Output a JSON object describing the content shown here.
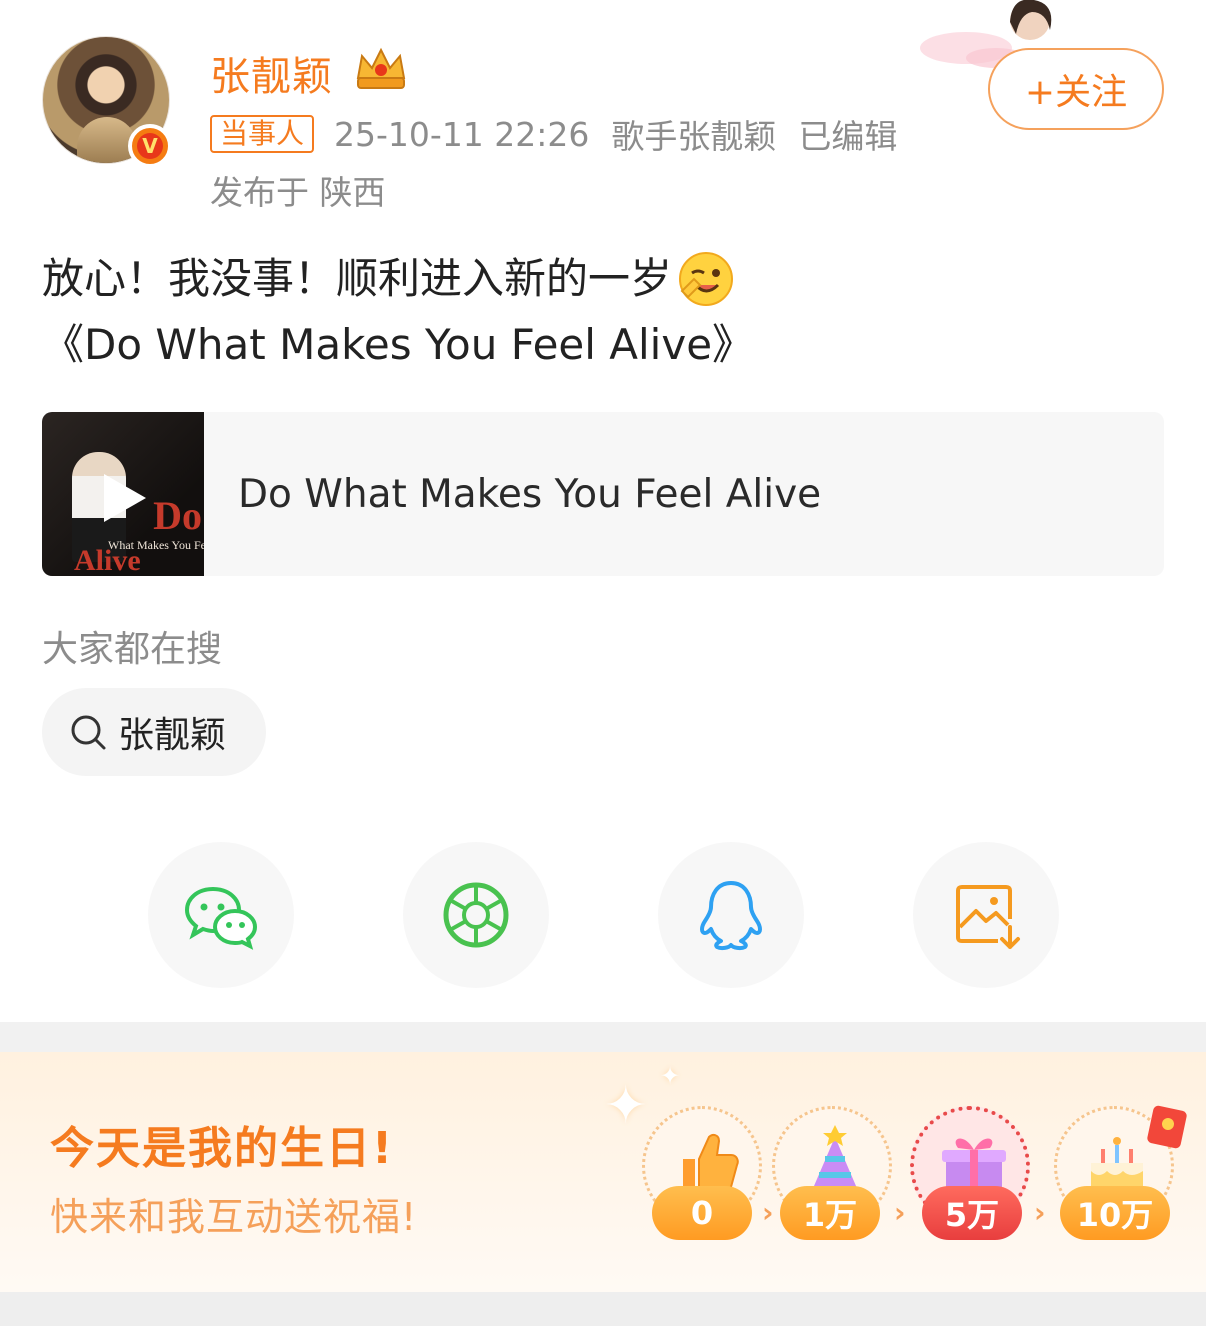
{
  "post": {
    "author_name": "张靓颖",
    "tag": "当事人",
    "timestamp": "25-10-11 22:26",
    "source": "歌手张靓颖",
    "edited": "已编辑",
    "location": "发布于 陕西",
    "follow_label": "+关注",
    "text_line1": "放心！我没事！顺利进入新的一岁",
    "text_line2": "《Do What Makes You Feel Alive》"
  },
  "music_card": {
    "title": "Do What Makes You Feel Alive",
    "cover_text_do": "Do",
    "cover_text_sub": "What Makes You Feel",
    "cover_text_alive": "Alive"
  },
  "search": {
    "label": "大家都在搜",
    "pill_text": "张靓颖"
  },
  "share": {
    "items": [
      "wechat-icon",
      "moments-icon",
      "qq-icon",
      "save-image-icon"
    ]
  },
  "birthday": {
    "title": "今天是我的生日!",
    "subtitle": "快来和我互动送祝福!",
    "milestones": [
      {
        "label": "0",
        "icon": "thumbs-up-icon"
      },
      {
        "label": "1万",
        "icon": "party-hat-icon"
      },
      {
        "label": "5万",
        "icon": "gift-box-icon"
      },
      {
        "label": "10万",
        "icon": "birthday-cake-icon"
      }
    ]
  },
  "colors": {
    "accent": "#f57b1f",
    "meta_gray": "#8c8c8c",
    "wechat": "#34c55a",
    "moments": "#49c24f",
    "qq": "#2ea1f2",
    "save": "#f59a1f",
    "milestone_active": "#e84a4a"
  }
}
